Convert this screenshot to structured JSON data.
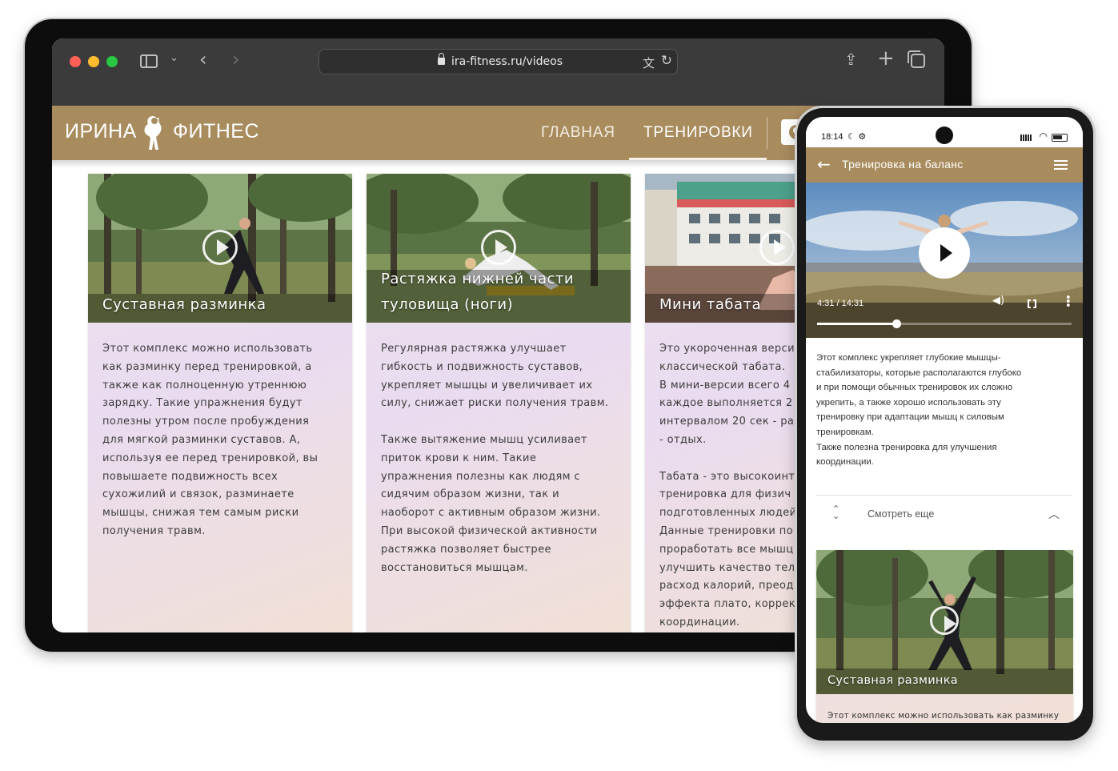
{
  "browser": {
    "url": "ira-fitness.ru/videos",
    "icons": [
      "sidebar-icon",
      "chevron-down-icon",
      "back-icon",
      "forward-icon",
      "lock-icon",
      "translate-icon",
      "reload-icon",
      "share-icon",
      "plus-icon",
      "tabs-icon"
    ]
  },
  "site": {
    "logo_left": "ИРИНА",
    "logo_right": "ФИТНЕС",
    "nav": [
      {
        "label": "ГЛАВНАЯ",
        "active": false
      },
      {
        "label": "ТРЕНИРОВКИ",
        "active": true
      }
    ],
    "brand_color": "#a98c5e"
  },
  "cards": [
    {
      "title": "Суставная разминка",
      "text": "Этот комплекс можно использовать\nкак разминку перед тренировкой, а\nтакже как полноценную утреннюю\nзарядку. Такие упражнения будут\nполезны утром после пробуждения\nдля мягкой разминки суставов. А,\nиспользуя ее перед тренировкой, вы\nповышаете подвижность всех\nсухожилий и связок, разминаете\nмышцы, снижая тем самым риски\nполучения травм."
    },
    {
      "title": "Растяжка нижней части\nтуловища (ноги)",
      "text": "Регулярная растяжка улучшает\nгибкость и подвижность суставов,\nукрепляет мышцы и увеличивает их\nсилу, снижает риски получения травм.\n\nТакже вытяжение мышц усиливает\nприток крови к ним. Такие\nупражнения полезны как людям с\nсидячим образом жизни, так и\nнаоборот с активным образом жизни.\nПри высокой физической активности\nрастяжка позволяет быстрее\nвосстановиться мышцам."
    },
    {
      "title": "Мини табата",
      "text": "Это укороченная верси\nклассической табата.\nВ мини-версии всего 4\nкаждое выполняется 2\nинтервалом 20 сек - ра\n- отдых.\n\nТабата - это высокоинт\nтренировка для физич\nподготовленных людей\nДанные тренировки по\nпроработать все мышц\nулучшить качество тел\nрасход калорий, преод\nэффекта плато, коррек\nкоординации."
    }
  ],
  "phone": {
    "status_time": "18:14",
    "status_extra": "☾ ⚙",
    "title": "Тренировка на баланс",
    "player": {
      "time": "4:31 / 14:31",
      "progress": 0.311
    },
    "description": "Этот комплекс укрепляет глубокие мышцы-\nстабилизаторы, которые располагаются глубоко\nи при помощи обычных тренировок их сложно\nукрепить, а также хорошо использовать эту\nтренировку при адаптации мышц к силовым\nтренировкам.\nТакже полезна тренировка для улучшения\nкоординации.",
    "more_label": "Смотреть еще",
    "card": {
      "title": "Суставная разминка",
      "text": "Этот комплекс можно использовать как разминку"
    }
  }
}
